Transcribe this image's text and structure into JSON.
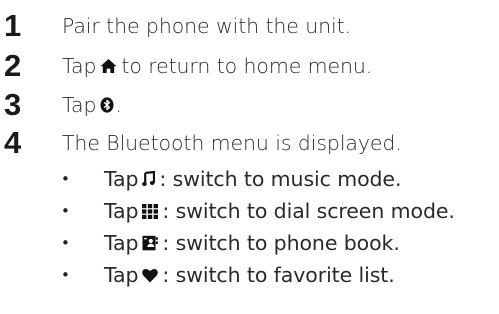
{
  "steps": [
    {
      "number": "1",
      "text": "Pair the phone with the unit."
    },
    {
      "number": "2",
      "before": "Tap",
      "icon": "home-icon",
      "after": "to return to home menu."
    },
    {
      "number": "3",
      "before": "Tap",
      "icon": "bluetooth-icon",
      "after": "."
    },
    {
      "number": "4",
      "text": "The Bluetooth menu is displayed."
    }
  ],
  "bullets": [
    {
      "before": "Tap",
      "icon": "music-note-icon",
      "after": ": switch to music mode."
    },
    {
      "before": "Tap",
      "icon": "dial-grid-icon",
      "after": ": switch to dial screen mode."
    },
    {
      "before": "Tap",
      "icon": "phone-book-icon",
      "after": ": switch to phone book."
    },
    {
      "before": "Tap",
      "icon": "heart-icon",
      "after": ": switch to favorite list."
    }
  ],
  "bullet_glyph": "•"
}
